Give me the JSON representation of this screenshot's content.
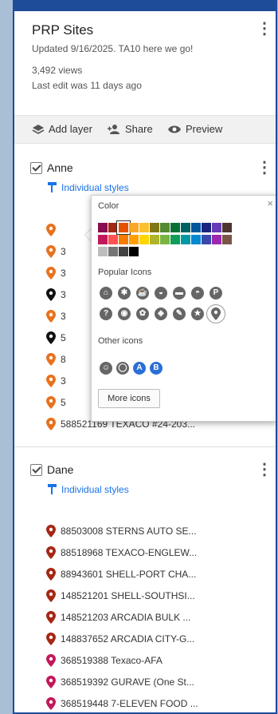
{
  "map_title": "PRP Sites",
  "updated": "Updated 9/16/2025. TA10 here we go!",
  "views": "3,492 views",
  "last_edit": "Last edit was 11 days ago",
  "actions": {
    "add_layer": "Add layer",
    "share": "Share",
    "preview": "Preview"
  },
  "layers": [
    {
      "name": "Anne",
      "styles_label": "Individual styles",
      "items": [
        {
          "label": "",
          "color": "#e8711c"
        },
        {
          "label": "3",
          "color": "#e8711c"
        },
        {
          "label": "3",
          "color": "#e8711c"
        },
        {
          "label": "3",
          "color": "#111111"
        },
        {
          "label": "3",
          "color": "#e8711c"
        },
        {
          "label": "5",
          "color": "#111111"
        },
        {
          "label": "8",
          "color": "#e8711c"
        },
        {
          "label": "3",
          "color": "#e8711c"
        },
        {
          "label": "5",
          "color": "#e8711c"
        },
        {
          "label": "588521169 TEXACO #24-203...",
          "color": "#e8711c"
        }
      ]
    },
    {
      "name": "Dane",
      "styles_label": "Individual styles",
      "items": [
        {
          "label": "88503008 STERNS AUTO SE...",
          "color": "#a52714"
        },
        {
          "label": "88518968 TEXACO-ENGLEW...",
          "color": "#a52714"
        },
        {
          "label": "88943601 SHELL-PORT CHA...",
          "color": "#a52714"
        },
        {
          "label": "148521201 SHELL-SOUTHSI...",
          "color": "#a52714"
        },
        {
          "label": "148521203 ARCADIA BULK ...",
          "color": "#a52714"
        },
        {
          "label": "148837652 ARCADIA CITY-G...",
          "color": "#a52714"
        },
        {
          "label": "368519388 Texaco-AFA",
          "color": "#c2185b"
        },
        {
          "label": "368519392 GURAVE (One St...",
          "color": "#c2185b"
        },
        {
          "label": "368519448 7-ELEVEN FOOD ...",
          "color": "#c2185b"
        }
      ]
    }
  ],
  "popup": {
    "color_label": "Color",
    "popular_label": "Popular Icons",
    "other_label": "Other icons",
    "more_label": "More icons",
    "close": "×",
    "palette_rows": [
      [
        "#880e4f",
        "#a52714",
        "#e65100",
        "#f9a825",
        "#fbc02d",
        "#827717",
        "#558b2f",
        "#097138",
        "#006064",
        "#01579b",
        "#1a237e",
        "#673ab7",
        "#4e342e"
      ],
      [
        "#c2185b",
        "#ff5252",
        "#f57c00",
        "#ffa000",
        "#ffd600",
        "#afb42b",
        "#7cb342",
        "#0f9d58",
        "#0097a7",
        "#0288d1",
        "#3949ab",
        "#9c27b0",
        "#795548"
      ],
      [
        "#bdbdbd",
        "#757575",
        "#424242",
        "#000000"
      ]
    ],
    "selected_color": "#e65100",
    "popular_icons": [
      [
        "home-icon",
        "star-icon",
        "cup-icon",
        "shop-icon",
        "bus-icon",
        "bag-icon",
        "parking-icon"
      ],
      [
        "question-icon",
        "camera-icon",
        "walk-icon",
        "bike-icon",
        "ski-icon",
        "flag-icon",
        "pin-icon"
      ]
    ],
    "popular_glyphs": [
      [
        "⌂",
        "✱",
        "☕",
        "◒",
        "▬",
        "◓",
        "P"
      ],
      [
        "?",
        "◉",
        "✿",
        "◈",
        "✎",
        "★",
        ""
      ]
    ],
    "other_icons": [
      "A",
      "B"
    ]
  }
}
